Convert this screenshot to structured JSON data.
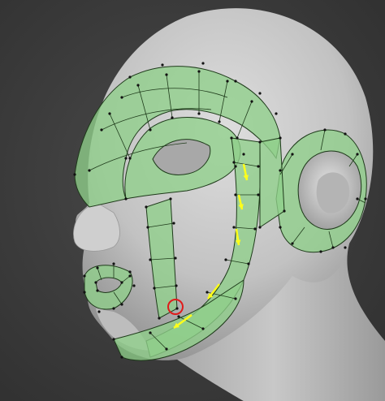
{
  "viewport": {
    "background_color": "#3a3a3a"
  },
  "model": {
    "skin_color": "#c9c9c9",
    "topology_fill_color": "#8fd08a",
    "topology_edge_color": "#1e3a1a",
    "vertex_color": "#111111"
  },
  "annotations": {
    "arrow_color": "#ffff1a",
    "arrow_count": 6,
    "highlight_circle_color": "#e01b1b",
    "highlight_count": 1
  }
}
